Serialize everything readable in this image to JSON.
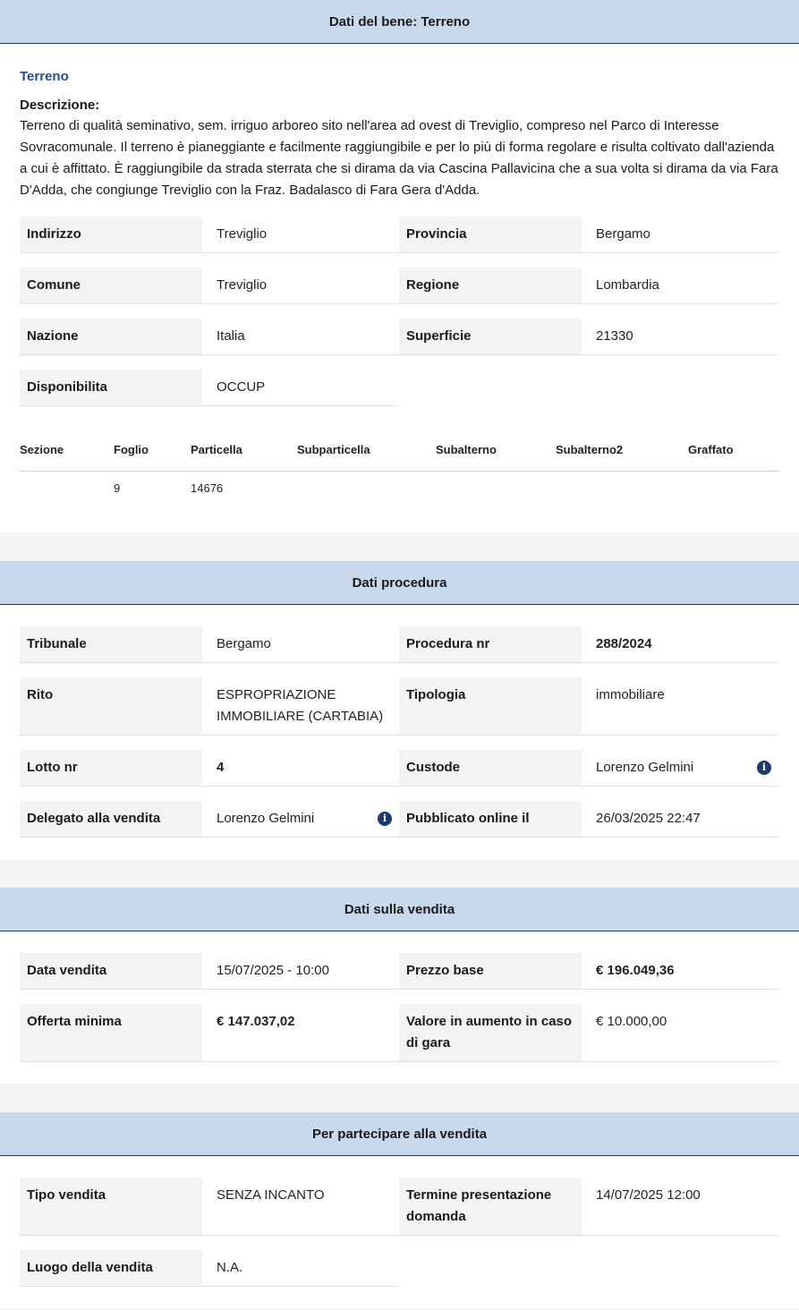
{
  "bene": {
    "header": "Dati del bene: Terreno",
    "title": "Terreno",
    "desc_label": "Descrizione:",
    "desc_lines": [
      "Terreno di qualità seminativo, sem. irriguo arboreo sito nell'area ad ovest di Treviglio, compreso nel Parco di Interesse",
      "Sovracomunale. Il terreno è pianeggiante e facilmente raggiungibile e per lo più di forma regolare e risulta coltivato dall'azienda",
      "a cui è affittato. È raggiungibile da strada sterrata che si dirama da via Cascina Pallavicina che a sua volta si dirama da via Fara",
      "D'Adda, che congiunge Treviglio con la Fraz. Badalasco di Fara Gera d'Adda."
    ],
    "fields": {
      "indirizzo_label": "Indirizzo",
      "indirizzo": "Treviglio",
      "provincia_label": "Provincia",
      "provincia": "Bergamo",
      "comune_label": "Comune",
      "comune": "Treviglio",
      "regione_label": "Regione",
      "regione": "Lombardia",
      "nazione_label": "Nazione",
      "nazione": "Italia",
      "superficie_label": "Superficie",
      "superficie": "21330",
      "disponibilita_label": "Disponibilita",
      "disponibilita": "OCCUP"
    },
    "catasto": {
      "headers": [
        "Sezione",
        "Foglio",
        "Particella",
        "Subparticella",
        "Subalterno",
        "Subalterno2",
        "Graffato"
      ],
      "row": [
        "",
        "9",
        "14676",
        "",
        "",
        "",
        ""
      ]
    }
  },
  "procedura": {
    "header": "Dati procedura",
    "tribunale_label": "Tribunale",
    "tribunale": "Bergamo",
    "procedura_label": "Procedura nr",
    "procedura": "288/2024",
    "rito_label": "Rito",
    "rito_line1": "ESPROPRIAZIONE",
    "rito_line2": "IMMOBILIARE (CARTABIA)",
    "tipologia_label": "Tipologia",
    "tipologia": "immobiliare",
    "lotto_label": "Lotto nr",
    "lotto": "4",
    "custode_label": "Custode",
    "custode": "Lorenzo Gelmini",
    "delegato_label": "Delegato alla vendita",
    "delegato": "Lorenzo Gelmini",
    "pubblicato_label": "Pubblicato online il",
    "pubblicato": "26/03/2025 22:47",
    "info_glyph": "i"
  },
  "vendita": {
    "header": "Dati sulla vendita",
    "data_label": "Data vendita",
    "data": "15/07/2025 - 10:00",
    "prezzo_label": "Prezzo base",
    "prezzo": "€ 196.049,36",
    "offerta_label": "Offerta minima",
    "offerta": "€ 147.037,02",
    "aumento_label_line1": "Valore in aumento in caso",
    "aumento_label_line2": "di gara",
    "aumento": "€ 10.000,00"
  },
  "partecipare": {
    "header": "Per partecipare alla vendita",
    "tipo_label": "Tipo vendita",
    "tipo": "SENZA INCANTO",
    "termine_label_line1": "Termine presentazione",
    "termine_label_line2": "domanda",
    "termine": "14/07/2025 12:00",
    "luogo_label": "Luogo della vendita",
    "luogo": "N.A."
  },
  "colors": {
    "header_bg": "#c9d9ec",
    "accent": "#1d4f91",
    "info_icon": "#1d3a6e"
  }
}
